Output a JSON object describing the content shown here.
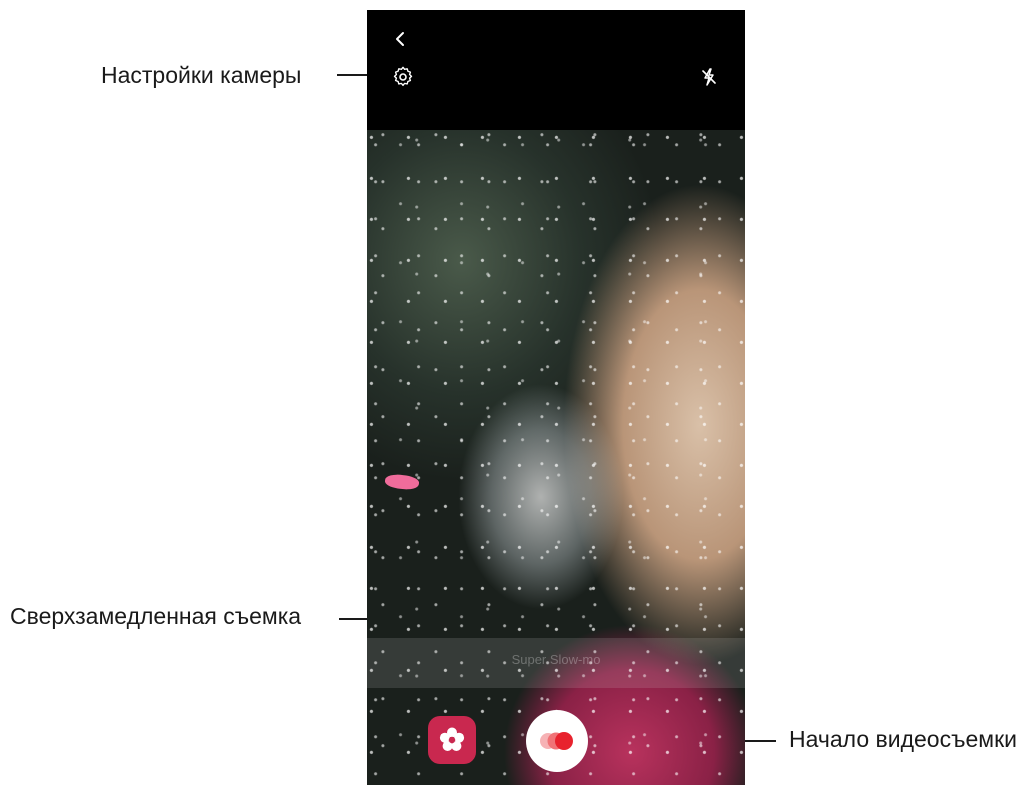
{
  "callouts": {
    "camera_settings": "Настройки камеры",
    "super_slow_mo": "Сверхзамедленная съемка",
    "start_recording": "Начало видеосъемки"
  },
  "camera": {
    "mode_label": "Super Slow-mo",
    "icons": {
      "back": "chevron-left-icon",
      "settings": "gear-icon",
      "flash": "flash-off-icon",
      "effects": "flower-icon",
      "record": "super-slow-mo-record-icon"
    },
    "colors": {
      "effects_button": "#c9284f",
      "record_dot": "#e8222d"
    }
  }
}
